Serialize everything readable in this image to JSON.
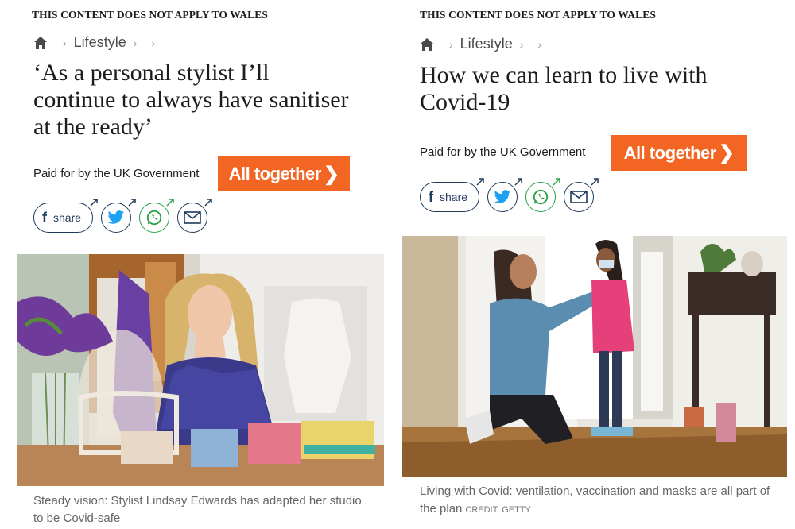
{
  "left": {
    "notice": "THIS CONTENT DOES NOT APPLY TO WALES",
    "breadcrumb": {
      "section": "Lifestyle"
    },
    "headline": "‘As a personal stylist I’ll continue to always have sanitiser at the ready’",
    "paid_by": "Paid for by the UK Government",
    "badge": "All together",
    "share_label": "share",
    "caption": "Steady vision: Stylist Lindsay Edwards has adapted her studio to be Covid-safe"
  },
  "right": {
    "notice": "THIS CONTENT DOES NOT APPLY TO WALES",
    "breadcrumb": {
      "section": "Lifestyle"
    },
    "headline": "How we can learn to live with Covid-19",
    "paid_by": "Paid for by the UK Government",
    "badge": "All together",
    "share_label": "share",
    "caption": "Living with Covid: ventilation, vaccination and masks are all part of the plan",
    "credit": "CREDIT: GETTY"
  },
  "colors": {
    "badge_orange": "#f26522",
    "share_navy": "#1f3b5c",
    "twitter_blue": "#1da1f2",
    "whatsapp_green": "#25a244"
  },
  "icons": [
    "home-icon",
    "chevron-right-icon",
    "facebook-icon",
    "twitter-icon",
    "whatsapp-icon",
    "email-icon",
    "external-arrow-icon"
  ]
}
